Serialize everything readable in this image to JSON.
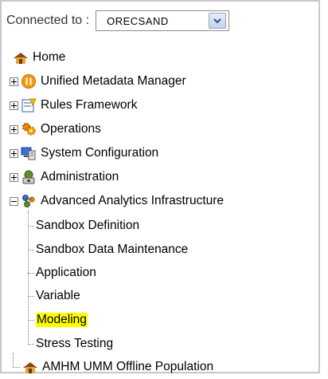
{
  "connection": {
    "label": "Connected to :",
    "selected": "ORECSAND"
  },
  "tree": {
    "home": "Home",
    "nodes": [
      {
        "label": "Unified Metadata Manager",
        "icon": "metadata-manager-icon"
      },
      {
        "label": "Rules Framework",
        "icon": "rules-framework-icon"
      },
      {
        "label": "Operations",
        "icon": "operations-gear-icon"
      },
      {
        "label": "System Configuration",
        "icon": "system-configuration-icon"
      },
      {
        "label": "Administration",
        "icon": "administration-icon"
      },
      {
        "label": "Advanced Analytics Infrastructure",
        "icon": "analytics-infrastructure-icon"
      }
    ],
    "children": [
      "Sandbox Definition",
      "Sandbox Data Maintenance",
      "Application",
      "Variable",
      "Modeling",
      "Stress Testing"
    ],
    "last": "AMHM UMM Offline Population"
  },
  "colors": {
    "highlight": "#ffff00",
    "border": "#c8c8c8"
  }
}
